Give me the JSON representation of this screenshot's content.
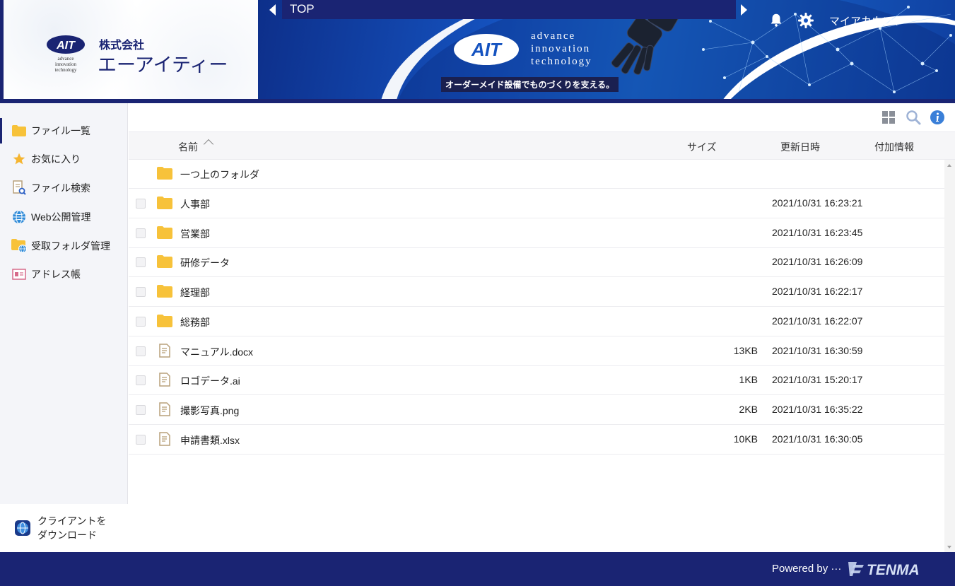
{
  "header": {
    "company_prefix": "株式会社",
    "company_name": "エーアイティー",
    "logo_mark_text": "AIT",
    "logo_small_text": [
      "advance",
      "innovation",
      "technology"
    ],
    "banner_brand": [
      "advance",
      "innovation",
      "technology"
    ],
    "banner_tagline": "オーダーメイド設備でものづくりを支える。",
    "breadcrumb": "TOP",
    "account_label": "マイアカウント"
  },
  "sidebar": {
    "items": [
      {
        "label": "ファイル一覧",
        "icon": "folder-icon"
      },
      {
        "label": "お気に入り",
        "icon": "star-icon"
      },
      {
        "label": "ファイル検索",
        "icon": "file-search-icon"
      },
      {
        "label": "Web公開管理",
        "icon": "globe-icon"
      },
      {
        "label": "受取フォルダ管理",
        "icon": "folder-globe-icon"
      },
      {
        "label": "アドレス帳",
        "icon": "address-card-icon"
      }
    ],
    "client_download": [
      "クライアントを",
      "ダウンロード"
    ]
  },
  "table": {
    "columns": {
      "name": "名前",
      "size": "サイズ",
      "updated": "更新日時",
      "extra": "付加情報"
    },
    "parent_folder": "一つ上のフォルダ",
    "rows": [
      {
        "type": "folder",
        "name": "人事部",
        "size": "",
        "updated": "2021/10/31 16:23:21"
      },
      {
        "type": "folder",
        "name": "営業部",
        "size": "",
        "updated": "2021/10/31 16:23:45"
      },
      {
        "type": "folder",
        "name": "研修データ",
        "size": "",
        "updated": "2021/10/31 16:26:09"
      },
      {
        "type": "folder",
        "name": "経理部",
        "size": "",
        "updated": "2021/10/31 16:22:17"
      },
      {
        "type": "folder",
        "name": "総務部",
        "size": "",
        "updated": "2021/10/31 16:22:07"
      },
      {
        "type": "file",
        "name": "マニュアル.docx",
        "size": "13KB",
        "updated": "2021/10/31 16:30:59"
      },
      {
        "type": "file",
        "name": "ロゴデータ.ai",
        "size": "1KB",
        "updated": "2021/10/31 15:20:17"
      },
      {
        "type": "file",
        "name": "撮影写真.png",
        "size": "2KB",
        "updated": "2021/10/31 16:35:22"
      },
      {
        "type": "file",
        "name": "申請書類.xlsx",
        "size": "10KB",
        "updated": "2021/10/31 16:30:05"
      }
    ]
  },
  "footer": {
    "powered_by": "Powered by ···",
    "brand": "TENMA"
  },
  "colors": {
    "navy": "#1a2473",
    "folder": "#f7c23a",
    "sidebar_bg": "#f4f5f9",
    "star": "#f5b531"
  }
}
